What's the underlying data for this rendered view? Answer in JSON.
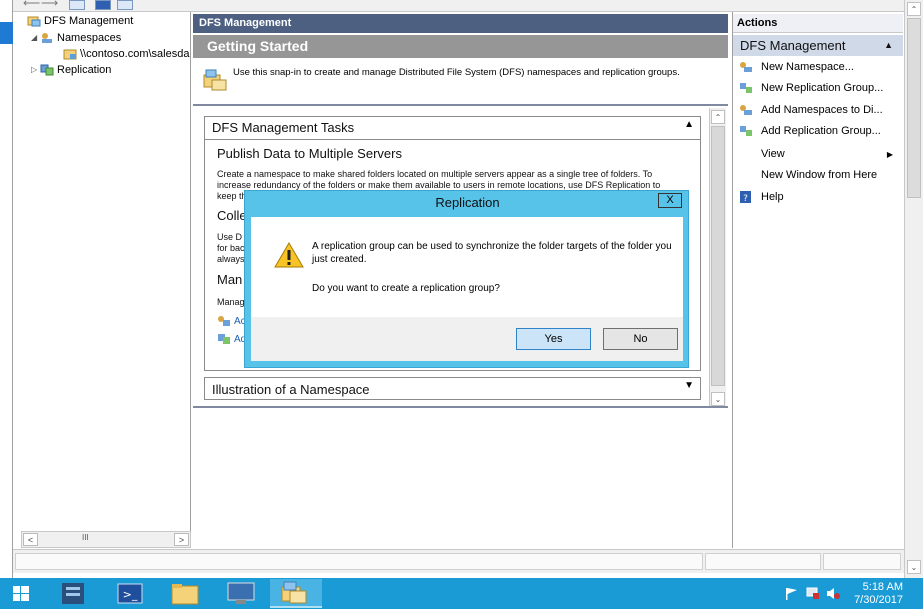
{
  "tree": {
    "root": "DFS Management",
    "namespaces": "Namespaces",
    "namespace_item": "\\\\contoso.com\\salesda",
    "replication": "Replication",
    "scroll_thumb": "III"
  },
  "center": {
    "header": "DFS Management",
    "getting_started": "Getting Started",
    "description": "Use this snap-in to create and manage Distributed File System (DFS) namespaces and replication groups.",
    "tasks_title": "DFS Management Tasks",
    "section1_title": "Publish Data to Multiple Servers",
    "section1_line1": "Create a namespace to make shared folders located on multiple servers appear as a single tree of folders. To",
    "section1_line2": "increase redundancy of the folders or make them available to users in remote locations, use DFS Replication to",
    "section1_line3": "keep th",
    "section2_title": "Colle",
    "section2_line1": "Use D",
    "section2_line2": "for bac",
    "section2_line3": "always",
    "section3_title": "Man",
    "section3_line1": "Manag",
    "link1": "Ac",
    "link2": "Ad",
    "illustration_title": "Illustration of a Namespace"
  },
  "actions": {
    "header": "Actions",
    "group": "DFS Management",
    "items": [
      {
        "label": "New Namespace...",
        "icon": "namespace-icon"
      },
      {
        "label": "New Replication Group...",
        "icon": "replication-icon"
      },
      {
        "label": "Add Namespaces to Di...",
        "icon": "namespace-add-icon"
      },
      {
        "label": "Add Replication Group...",
        "icon": "replication-add-icon"
      },
      {
        "label": "View",
        "icon": ""
      },
      {
        "label": "New Window from Here",
        "icon": ""
      },
      {
        "label": "Help",
        "icon": "help-icon"
      }
    ]
  },
  "dialog": {
    "title": "Replication",
    "close": "X",
    "message": "A replication group can be used to synchronize the folder targets of the folder you just created.",
    "question": "Do you want to create a replication group?",
    "yes": "Yes",
    "no": "No"
  },
  "taskbar": {
    "time": "5:18 AM",
    "date": "7/30/2017"
  },
  "colors": {
    "taskbar": "#1b9bd6",
    "dialog_frame": "#57c3e8",
    "pane_header": "#4d6082"
  }
}
